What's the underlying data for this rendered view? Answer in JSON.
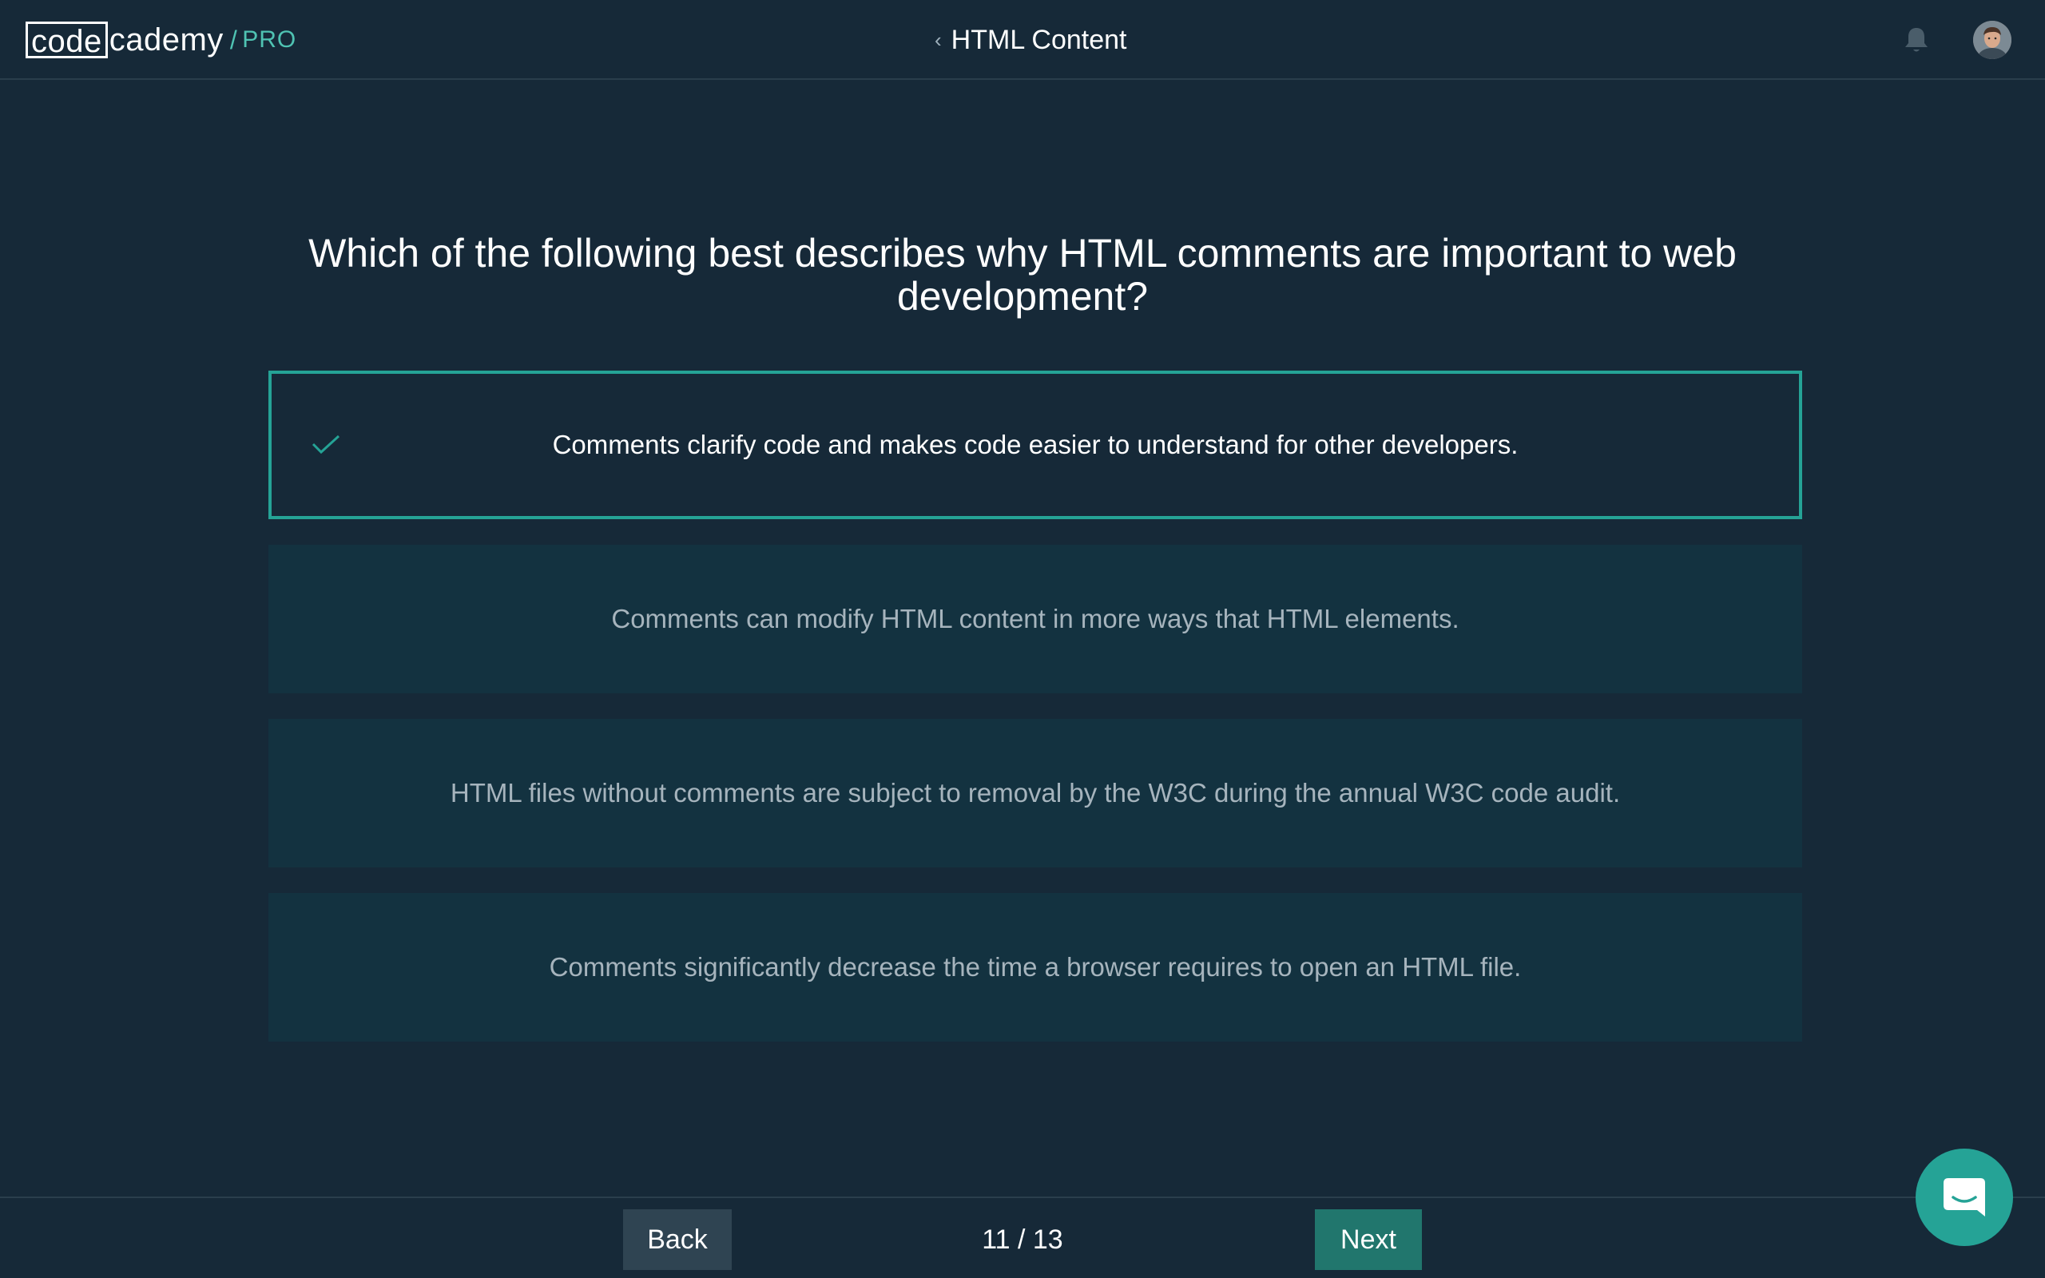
{
  "header": {
    "logo_code": "code",
    "logo_rest": "cademy",
    "logo_separator": "/",
    "logo_tier": "PRO",
    "lesson_title": "HTML Content",
    "back_chevron": "‹"
  },
  "quiz": {
    "question": "Which of the following best describes why HTML comments are important to web development?",
    "answers": [
      {
        "text": "Comments clarify code and makes code easier to understand for other developers.",
        "selected": true
      },
      {
        "text": "Comments can modify HTML content in more ways that HTML elements.",
        "selected": false
      },
      {
        "text": "HTML files without comments are subject to removal by the W3C during the annual W3C code audit.",
        "selected": false
      },
      {
        "text": "Comments significantly decrease the time a browser requires to open an HTML file.",
        "selected": false
      }
    ]
  },
  "footer": {
    "back_label": "Back",
    "next_label": "Next",
    "progress": "11 / 13"
  },
  "icons": {
    "bell": "bell-icon",
    "check": "checkmark-icon",
    "chat": "chat-icon",
    "avatar": "avatar"
  },
  "colors": {
    "background": "#162938",
    "accent": "#25a396",
    "answer_bg": "#133240",
    "back_button": "#2f4452",
    "next_button": "#21766d"
  }
}
